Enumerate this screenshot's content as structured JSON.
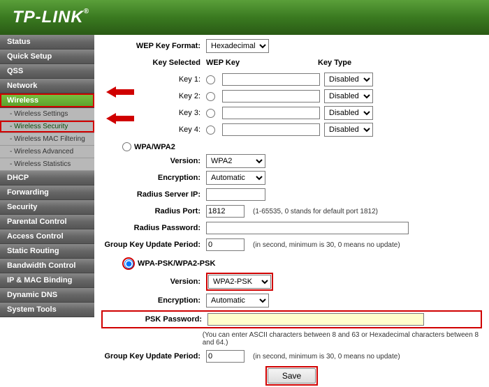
{
  "brand": "TP-LINK",
  "sidebar": {
    "items": [
      {
        "label": "Status"
      },
      {
        "label": "Quick Setup"
      },
      {
        "label": "QSS"
      },
      {
        "label": "Network"
      },
      {
        "label": "Wireless",
        "active": true
      },
      {
        "label": "DHCP"
      },
      {
        "label": "Forwarding"
      },
      {
        "label": "Security"
      },
      {
        "label": "Parental Control"
      },
      {
        "label": "Access Control"
      },
      {
        "label": "Static Routing"
      },
      {
        "label": "Bandwidth Control"
      },
      {
        "label": "IP & MAC Binding"
      },
      {
        "label": "Dynamic DNS"
      },
      {
        "label": "System Tools"
      }
    ],
    "wireless_subs": [
      {
        "label": "- Wireless Settings"
      },
      {
        "label": "- Wireless Security",
        "active": true
      },
      {
        "label": "- Wireless MAC Filtering"
      },
      {
        "label": "- Wireless Advanced"
      },
      {
        "label": "- Wireless Statistics"
      }
    ]
  },
  "wep": {
    "format_label": "WEP Key Format:",
    "format_value": "Hexadecimal",
    "header_key_selected": "Key Selected",
    "header_wep_key": "WEP Key",
    "header_key_type": "Key Type",
    "keys": [
      {
        "label": "Key 1:",
        "type": "Disabled"
      },
      {
        "label": "Key 2:",
        "type": "Disabled"
      },
      {
        "label": "Key 3:",
        "type": "Disabled"
      },
      {
        "label": "Key 4:",
        "type": "Disabled"
      }
    ]
  },
  "wpa": {
    "title": "WPA/WPA2",
    "version_label": "Version:",
    "version_value": "WPA2",
    "encryption_label": "Encryption:",
    "encryption_value": "Automatic",
    "radius_ip_label": "Radius Server IP:",
    "radius_ip_value": "",
    "radius_port_label": "Radius Port:",
    "radius_port_value": "1812",
    "radius_port_hint": "(1-65535, 0 stands for default port 1812)",
    "radius_pw_label": "Radius Password:",
    "radius_pw_value": "",
    "gkup_label": "Group Key Update Period:",
    "gkup_value": "0",
    "gkup_hint": "(in second, minimum is 30, 0 means no update)"
  },
  "psk": {
    "title": "WPA-PSK/WPA2-PSK",
    "version_label": "Version:",
    "version_value": "WPA2-PSK",
    "encryption_label": "Encryption:",
    "encryption_value": "Automatic",
    "password_label": "PSK Password:",
    "password_value": "",
    "password_hint": "(You can enter ASCII characters between 8 and 63 or Hexadecimal characters between 8 and 64.)",
    "gkup_label": "Group Key Update Period:",
    "gkup_value": "0",
    "gkup_hint": "(in second, minimum is 30, 0 means no update)"
  },
  "save_label": "Save"
}
